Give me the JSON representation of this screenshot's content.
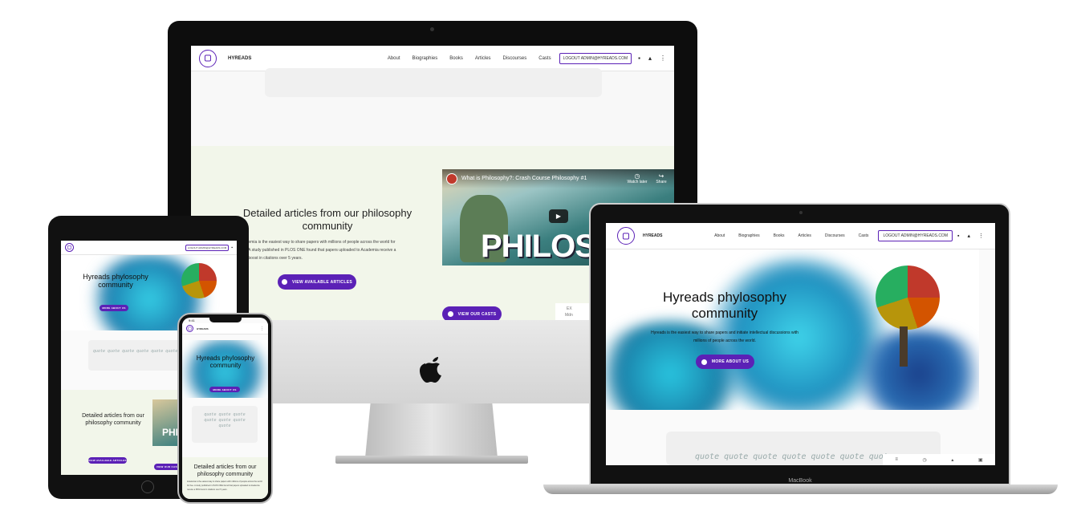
{
  "site": {
    "brand": "HYREADS",
    "nav": [
      "About",
      "Biographies",
      "Books",
      "Articles",
      "Discourses",
      "Casts"
    ],
    "logout": "LOGOUT ADMIN@HYREADS.COM"
  },
  "hero": {
    "title": "Hyreads phylosophy community",
    "subtitle": "Hyreads is the easiest way to share papers and initiate intellectual discussions with millions of people across the world.",
    "button": "MORE ABOUT US"
  },
  "articles": {
    "title": "Detailed articles from our philosophy community",
    "body": "Academia is the easiest way to share papers with millions of people across the world for free. A study published in PLOS ONE found that papers uploaded to Academia receive a 69% boost in citations over 5 years.",
    "button": "VIEW AVAILABLE ARTICLES"
  },
  "casts": {
    "button": "VIEW OUR CASTS"
  },
  "video": {
    "title": "What is Philosophy?: Crash Course Philosophy #1",
    "watch_later": "Watch later",
    "share": "Share",
    "big_text": "PHILOSO"
  },
  "quote": {
    "text": "quote quote quote quote quote quote quote"
  },
  "bottom_bar": [
    "EX",
    "Mdn"
  ],
  "phone": {
    "time": "9:41",
    "title": "Detailed articles from our philosophy community"
  },
  "laptop": {
    "label": "MacBook"
  },
  "colors": {
    "accent": "#5b21b6",
    "mint": "#f2f6ea"
  }
}
